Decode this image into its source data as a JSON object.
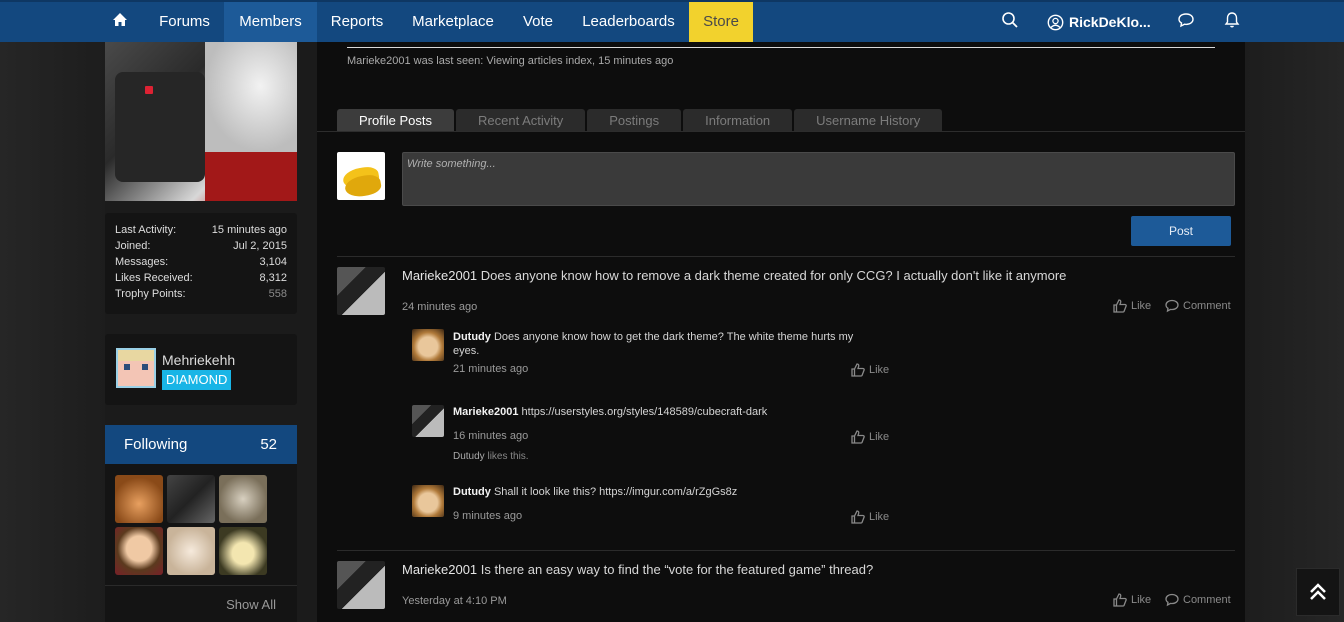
{
  "nav": {
    "items": [
      "Forums",
      "Members",
      "Reports",
      "Marketplace",
      "Vote",
      "Leaderboards",
      "Store"
    ],
    "active": "Members",
    "user": "RickDeKlo..."
  },
  "sidebar": {
    "stats": [
      {
        "label": "Last Activity:",
        "value": "15 minutes ago"
      },
      {
        "label": "Joined:",
        "value": "Jul 2, 2015"
      },
      {
        "label": "Messages:",
        "value": "3,104"
      },
      {
        "label": "Likes Received:",
        "value": "8,312"
      },
      {
        "label": "Trophy Points:",
        "value": "558"
      }
    ],
    "rank": {
      "name": "Mehriekehh",
      "badge": "DIAMOND"
    },
    "following": {
      "title": "Following",
      "count": "52",
      "show_all": "Show All"
    }
  },
  "profile": {
    "last_seen": "Marieke2001 was last seen: Viewing articles index, 15 minutes ago",
    "tabs": [
      "Profile Posts",
      "Recent Activity",
      "Postings",
      "Information",
      "Username History"
    ],
    "write_placeholder": "Write something...",
    "post_button": "Post"
  },
  "posts": [
    {
      "user": "Marieke2001",
      "text": "Does anyone know how to remove a dark theme created for only CCG? I actually don't like it anymore",
      "time": "24 minutes ago",
      "like": "Like",
      "comment": "Comment",
      "comments": [
        {
          "user": "Dutudy",
          "text": "Does anyone know how to get the dark theme? The white theme hurts my",
          "text2": "eyes.",
          "time": "21 minutes ago",
          "like": "Like"
        },
        {
          "user": "Marieke2001",
          "text": "https://userstyles.org/styles/148589/cubecraft-dark",
          "time": "16 minutes ago",
          "like": "Like",
          "likes_user": "Dutudy",
          "likes_suffix": " likes this."
        },
        {
          "user": "Dutudy",
          "text": "Shall it look like this? https://imgur.com/a/rZgGs8z",
          "time": "9 minutes ago",
          "like": "Like"
        }
      ]
    },
    {
      "user": "Marieke2001",
      "text": "Is there an easy way to find the “vote for the featured game” thread?",
      "time": "Yesterday at 4:10 PM",
      "like": "Like",
      "comment": "Comment"
    }
  ],
  "icons": {
    "home": "home-icon",
    "search": "search-icon",
    "user": "user-icon",
    "messages": "chat-bubble-icon",
    "alerts": "bell-icon",
    "like": "thumbs-up-icon",
    "comment": "comment-icon",
    "back_to_top": "double-chevron-up-icon"
  },
  "colors": {
    "nav_bg": "#13487f",
    "nav_active": "#1d5a98",
    "store": "#f2d22d",
    "badge": "#19b5e6",
    "main_bg": "#0d0d0d"
  }
}
